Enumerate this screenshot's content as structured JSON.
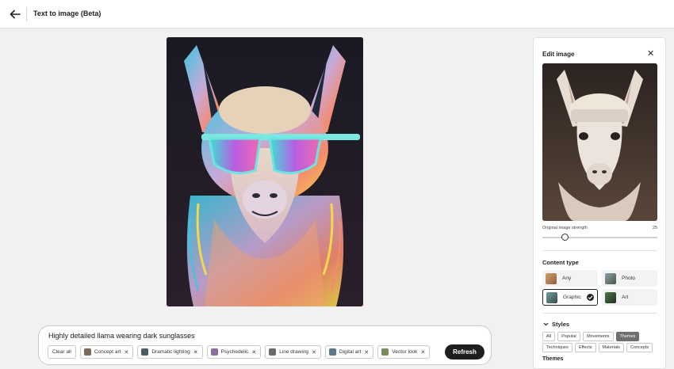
{
  "header": {
    "title": "Text to image (Beta)"
  },
  "prompt": {
    "text": "Highly detailed llama wearing dark sunglasses",
    "clear_label": "Clear all",
    "chips": [
      {
        "label": "Concept art",
        "color": "#7c6a5a"
      },
      {
        "label": "Dramatic lighting",
        "color": "#4d5a66"
      },
      {
        "label": "Psychedelic",
        "color": "#8a6fa0"
      },
      {
        "label": "Line drawing",
        "color": "#6b6b6b"
      },
      {
        "label": "Digital art",
        "color": "#5b7b8a"
      },
      {
        "label": "Vector look",
        "color": "#7a8b5b"
      }
    ],
    "refresh_label": "Refresh"
  },
  "panel": {
    "title": "Edit image",
    "strength_label": "Original image strength",
    "strength_value": "25",
    "content_type_title": "Content type",
    "content_types": [
      {
        "label": "Any",
        "selected": false
      },
      {
        "label": "Photo",
        "selected": false
      },
      {
        "label": "Graphic",
        "selected": true
      },
      {
        "label": "Art",
        "selected": false
      }
    ],
    "styles_title": "Styles",
    "style_tabs_row1": [
      "All",
      "Popular",
      "Movements",
      "Themes"
    ],
    "style_tabs_row2": [
      "Techniques",
      "Effects",
      "Materials",
      "Concepts"
    ],
    "active_tab": "Themes",
    "themes_title": "Themes"
  },
  "colors": {
    "accent": "#1f1f1f",
    "panel_bg": "#ffffff",
    "page_bg": "#f1f1f1"
  }
}
